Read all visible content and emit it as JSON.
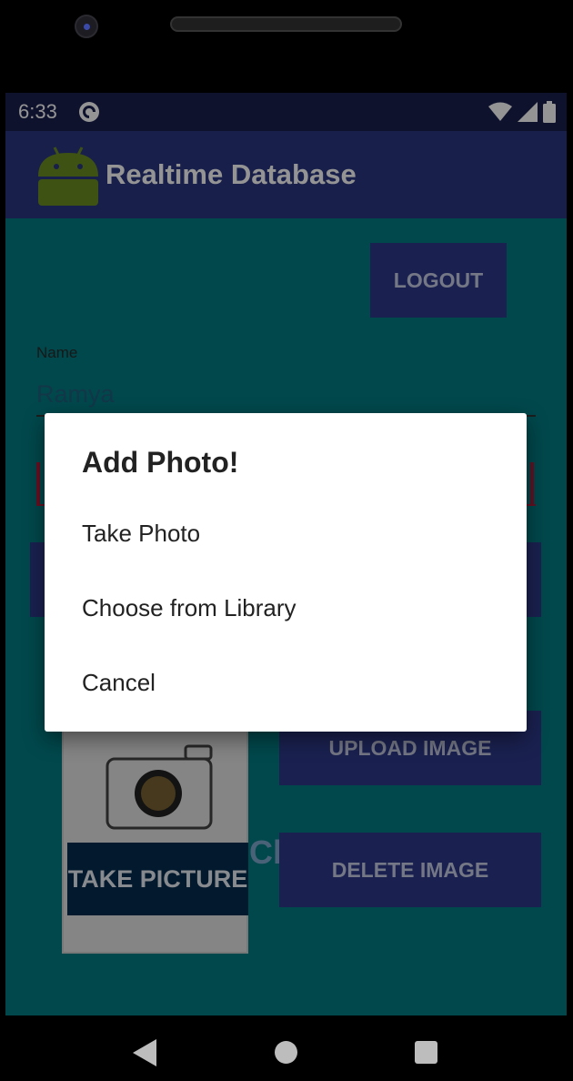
{
  "status_bar": {
    "time": "6:33",
    "notification_icon": "pocket-casts-icon",
    "wifi_icon": "wifi-icon",
    "signal_icon": "cell-signal-icon",
    "battery_icon": "battery-icon"
  },
  "app_bar": {
    "logo_icon": "android-robot-icon",
    "title": "Realtime Database"
  },
  "screen": {
    "logout_label": "LOGOUT",
    "name_label": "Name",
    "name_value": "Ramya",
    "upload_label": "UPLOAD IMAGE",
    "delete_label": "DELETE IMAGE",
    "picture_label": "TAKE PICTURE",
    "picture_icon": "camera-icon",
    "cloud_fragment": "Clo"
  },
  "dialog": {
    "title": "Add Photo!",
    "items": [
      "Take Photo",
      "Choose from Library",
      "Cancel"
    ]
  },
  "nav_bar": {
    "back_icon": "back-triangle-icon",
    "home_icon": "home-circle-icon",
    "recents_icon": "recents-square-icon"
  },
  "colors": {
    "status_bar": "#19204f",
    "app_bar": "#2a3680",
    "background": "#027c83",
    "button": "#2e3a8a",
    "error": "#b01d3c"
  }
}
